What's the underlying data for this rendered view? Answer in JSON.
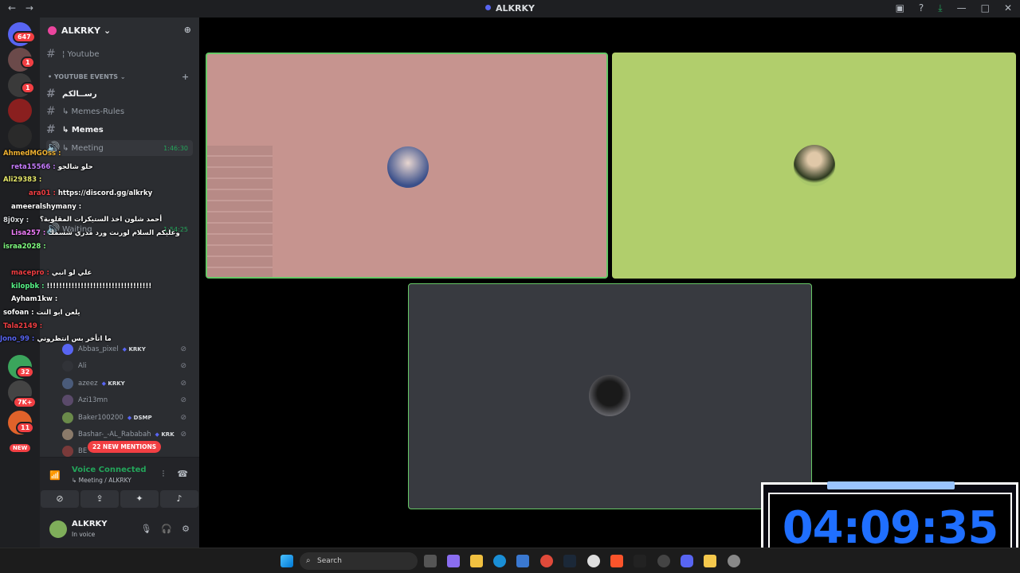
{
  "window": {
    "title": "ALKRKY"
  },
  "guilds": {
    "home_badge": "647",
    "badges": [
      "1",
      "1",
      "32",
      "7K+",
      "11"
    ],
    "new_label": "NEW"
  },
  "server": {
    "name": "ALKRKY"
  },
  "channels": [
    {
      "name": "¦ Youtube"
    },
    {
      "name": "رســالكم"
    },
    {
      "name": "↳ Memes-Rules"
    },
    {
      "name": "↳ Memes"
    },
    {
      "name": "↳ Meeting",
      "time": "1:46:30"
    },
    {
      "name": "Waiting",
      "time": "1:54:25"
    }
  ],
  "category": {
    "name": "• YOUTUBE EVENTS"
  },
  "members": [
    {
      "name": "Abbas_pixel",
      "tag": "KRKY"
    },
    {
      "name": "Ali",
      "tag": ""
    },
    {
      "name": "azeez",
      "tag": "KRKY"
    },
    {
      "name": "Azi13mn",
      "tag": ""
    },
    {
      "name": "Baker100200",
      "tag": "DSMP"
    },
    {
      "name": "Bashar-_-AL_Rababah",
      "tag": "KRK"
    },
    {
      "name": "BE",
      "tag": ""
    }
  ],
  "mentions": "22 NEW MENTIONS",
  "voice": {
    "status": "Voice Connected",
    "channel": "↳ Meeting / ALKRKY"
  },
  "user": {
    "name": "ALKRKY",
    "status": "In voice"
  },
  "chat_overlay": [
    {
      "user": "AhmedMGOss :",
      "msg": "",
      "color": "#f0b232"
    },
    {
      "user": "reta15566 :",
      "msg": "حلو شالجو",
      "color": "#c77dff"
    },
    {
      "user": "Ali29383 :",
      "msg": "",
      "color": "#e6e86a"
    },
    {
      "user": "ara01 :",
      "msg": "https://discord.gg/alkrky",
      "color": "#f23f43"
    },
    {
      "user": "ameeralshymany :",
      "msg": "",
      "color": "#ffffff"
    },
    {
      "user": "",
      "msg": "أحمد شلون اخذ الستيكرات المقلوبة؟",
      "color": "#ffffff"
    },
    {
      "user": "8j0xy :",
      "msg": "",
      "color": "#dbdee1"
    },
    {
      "user": "Lisa257 :",
      "msg": "وعليكم السلام لورنت ورد مدري شسمك",
      "color": "#f47fff"
    },
    {
      "user": "israa2028 :",
      "msg": "",
      "color": "#80ff80"
    },
    {
      "user": "",
      "msg": "",
      "color": "#dbdee1"
    },
    {
      "user": "macepro :",
      "msg": "علي لو انبي",
      "color": "#f23f43"
    },
    {
      "user": "kilopbk :",
      "msg": "!!!!!!!!!!!!!!!!!!!!!!!!!!!!!!!!!!",
      "color": "#57f287"
    },
    {
      "user": "Ayham1kw :",
      "msg": "",
      "color": "#ffffff"
    },
    {
      "user": "sofoan :",
      "msg": "يلعن ابو النت",
      "color": "#ffffff"
    },
    {
      "user": "Tala2149 :",
      "msg": "",
      "color": "#f23f43"
    },
    {
      "user": "Jono_99 :",
      "msg": "ما اتأخر بس انتظروني",
      "color": "#5865f2"
    }
  ],
  "stage": {
    "tiles": [
      {
        "bg": "#c6948f",
        "border": "#67c867"
      },
      {
        "bg": "#b1ce6c",
        "border": "#b1ce6c"
      },
      {
        "bg": "#383a40",
        "border": "#67c867"
      }
    ]
  },
  "taskbar": {
    "search_label": "Search"
  },
  "clock": {
    "time": "04:09:35"
  }
}
